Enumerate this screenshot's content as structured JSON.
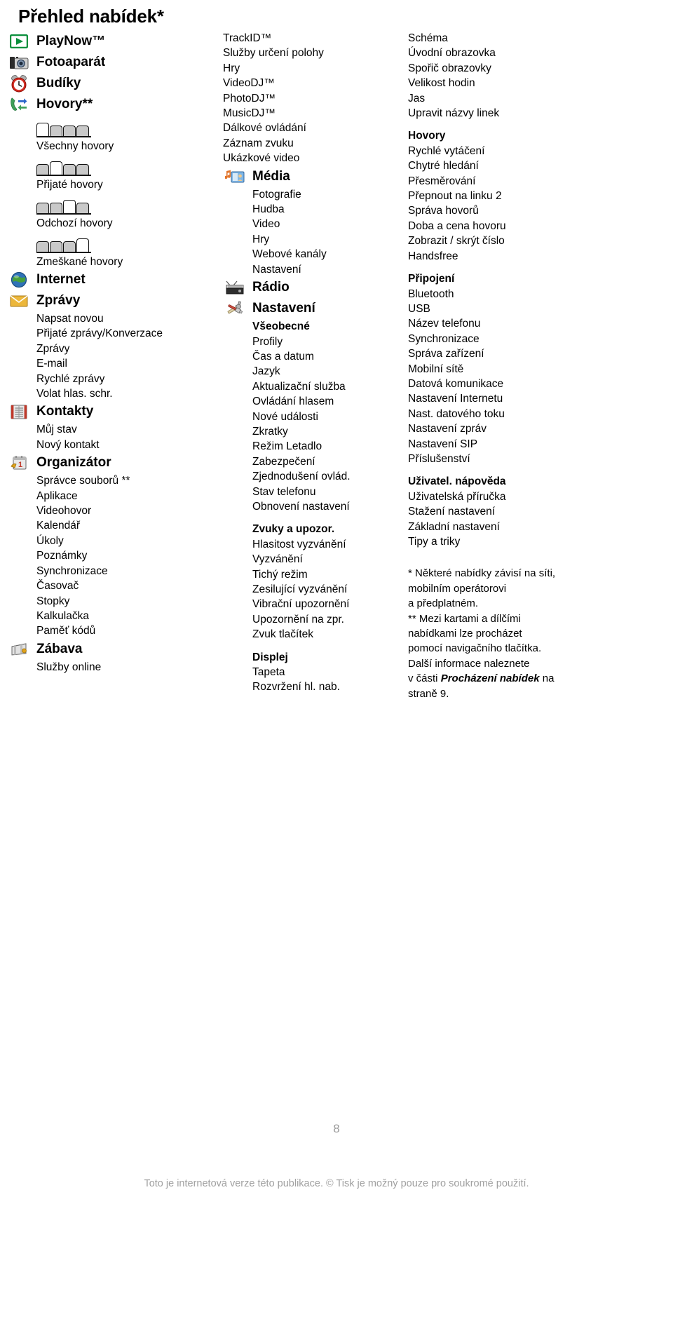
{
  "page": {
    "title": "Přehled nabídek*",
    "page_number": "8",
    "footer_note": "Toto je internetová verze této publikace. © Tisk je možný pouze pro soukromé použití."
  },
  "columns": {
    "left": [
      {
        "icon": "playnow-icon",
        "title": "PlayNow™",
        "items": []
      },
      {
        "icon": "camera-icon",
        "title": "Fotoaparát",
        "items": []
      },
      {
        "icon": "alarm-clock-icon",
        "title": "Budíky",
        "items": []
      },
      {
        "icon": "calls-icon",
        "title": "Hovory**",
        "call_tabs": [
          {
            "label": "Všechny hovory",
            "active_index": 0
          },
          {
            "label": "Přijaté hovory",
            "active_index": 1
          },
          {
            "label": "Odchozí hovory",
            "active_index": 2
          },
          {
            "label": "Zmeškané hovory",
            "active_index": 3
          }
        ],
        "items": []
      },
      {
        "icon": "globe-icon",
        "title": "Internet",
        "items": []
      },
      {
        "icon": "envelope-icon",
        "title": "Zprávy",
        "items": [
          "Napsat novou",
          "Přijaté zprávy/Konverzace",
          "Zprávy",
          "E-mail",
          "Rychlé zprávy",
          "Volat hlas. schr."
        ]
      },
      {
        "icon": "contacts-book-icon",
        "title": "Kontakty",
        "items": [
          "Můj stav",
          "Nový kontakt"
        ]
      },
      {
        "icon": "organizer-calendar-icon",
        "title": "Organizátor",
        "items": [
          "Správce souborů **",
          "Aplikace",
          "Videohovor",
          "Kalendář",
          "Úkoly",
          "Poznámky",
          "Synchronizace",
          "Časovač",
          "Stopky",
          "Kalkulačka",
          "Paměť kódů"
        ]
      },
      {
        "icon": "entertainment-icon",
        "title": "Zábava",
        "items": [
          "Služby online"
        ]
      }
    ],
    "middle": {
      "top_list": [
        "TrackID™",
        "Služby určení polohy",
        "Hry",
        "VideoDJ™",
        "PhotoDJ™",
        "MusicDJ™",
        "Dálkové ovládání",
        "Záznam zvuku",
        "Ukázkové video"
      ],
      "groups": [
        {
          "icon": "media-icon",
          "title": "Média",
          "items": [
            "Fotografie",
            "Hudba",
            "Video",
            "Hry",
            "Webové kanály",
            "Nastavení"
          ]
        },
        {
          "icon": "radio-icon",
          "title": "Rádio",
          "items": []
        },
        {
          "icon": "settings-tools-icon",
          "title": "Nastavení",
          "sections": [
            {
              "heading": "Všeobecné",
              "items": [
                "Profily",
                "Čas a datum",
                "Jazyk",
                "Aktualizační služba",
                "Ovládání hlasem",
                "Nové události",
                "Zkratky",
                "Režim Letadlo",
                "Zabezpečení",
                "Zjednodušení ovlád.",
                "Stav telefonu",
                "Obnovení nastavení"
              ]
            },
            {
              "heading": "Zvuky a upozor.",
              "items": [
                "Hlasitost vyzvánění",
                "Vyzvánění",
                "Tichý režim",
                "Zesilující vyzvánění",
                "Vibrační upozornění",
                "Upozornění na zpr.",
                "Zvuk tlačítek"
              ]
            },
            {
              "heading": "Displej",
              "items": [
                "Tapeta",
                "Rozvržení hl. nab."
              ]
            }
          ]
        }
      ]
    },
    "right": {
      "sections": [
        {
          "heading": "",
          "items": [
            "Schéma",
            "Úvodní obrazovka",
            "Spořič obrazovky",
            "Velikost hodin",
            "Jas",
            "Upravit názvy linek"
          ]
        },
        {
          "heading": "Hovory",
          "items": [
            "Rychlé vytáčení",
            "Chytré hledání",
            "Přesměrování",
            "Přepnout na linku 2",
            "Správa hovorů",
            "Doba a cena hovoru",
            "Zobrazit / skrýt číslo",
            "Handsfree"
          ]
        },
        {
          "heading": "Připojení",
          "items": [
            "Bluetooth",
            "USB",
            "Název telefonu",
            "Synchronizace",
            "Správa zařízení",
            "Mobilní sítě",
            "Datová komunikace",
            "Nastavení Internetu",
            "Nast. datového toku",
            "Nastavení zpráv",
            "Nastavení SIP",
            "Příslušenství"
          ]
        },
        {
          "heading": "Uživatel. nápověda",
          "items": [
            "Uživatelská příručka",
            "Stažení nastavení",
            "Základní nastavení",
            "Tipy a triky"
          ]
        }
      ],
      "footnote_lines": [
        {
          "text": "* Některé nabídky závisí na síti,"
        },
        {
          "text": "mobilním operátorovi"
        },
        {
          "text": "a předplatném."
        },
        {
          "text": "** Mezi kartami a dílčími"
        },
        {
          "text": "nabídkami lze procházet"
        },
        {
          "text": "pomocí navigačního tlačítka."
        },
        {
          "text": "Další informace naleznete"
        },
        {
          "pre": "v části ",
          "italic": "Procházení nabídek",
          "post": " na"
        },
        {
          "text": "straně 9."
        }
      ]
    }
  }
}
